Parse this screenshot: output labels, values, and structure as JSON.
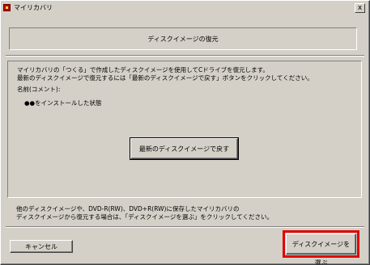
{
  "window": {
    "title": "マイリカバリ",
    "close_label": "x"
  },
  "header": {
    "title": "ディスクイメージの復元"
  },
  "main": {
    "description_line1": "マイリカバリの「つくる」で作成したディスクイメージを使用してCドライブを復元します。",
    "description_line2": "最新のディスクイメージで復元するには「最新のディスクイメージで戻す」ボタンをクリックしてください。",
    "name_label": "名前(コメント):",
    "name_value": "●●をインストールした状態",
    "restore_latest_button": "最新のディスクイメージで戻す"
  },
  "footer": {
    "note_line1": "他のディスクイメージや、DVD-R(RW)、DVD+R(RW)に保存したマイリカバリの",
    "note_line2": "ディスクイメージから復元する場合は、「ディスクイメージを選ぶ」をクリックしてください。",
    "cancel_button": "キャンセル",
    "choose_image_button": "ディスクイメージを選ぶ",
    "highlight_color": "#e00000"
  }
}
